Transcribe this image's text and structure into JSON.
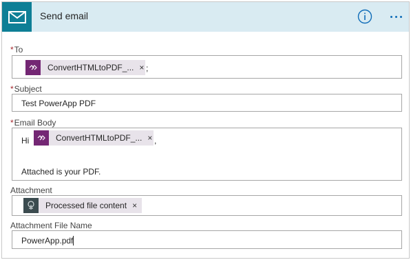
{
  "header": {
    "title": "Send email",
    "icon": "mail-icon",
    "color": "#0e7f96",
    "bg": "#d9ebf2"
  },
  "fields": {
    "to": {
      "label": "To",
      "required_mark": "*",
      "token": "ConvertHTMLtoPDF_...",
      "token_close": "×",
      "suffix": ";"
    },
    "subject": {
      "label": "Subject",
      "required_mark": "*",
      "value": "Test PowerApp PDF"
    },
    "email_body": {
      "label": "Email Body",
      "required_mark": "*",
      "prefix": "Hi",
      "token": "ConvertHTMLtoPDF_...",
      "token_close": "×",
      "suffix": ",",
      "line2": "Attached is your PDF."
    },
    "attachment": {
      "label": "Attachment",
      "token": "Processed file content",
      "token_close": "×"
    },
    "attachment_file_name": {
      "label": "Attachment File Name",
      "value": "PowerApp.pdf"
    }
  },
  "colors": {
    "powerapps_token": "#742774",
    "encodian_token": "#3b4b4f",
    "required": "#a4262c",
    "accent": "#0e6cb8"
  }
}
